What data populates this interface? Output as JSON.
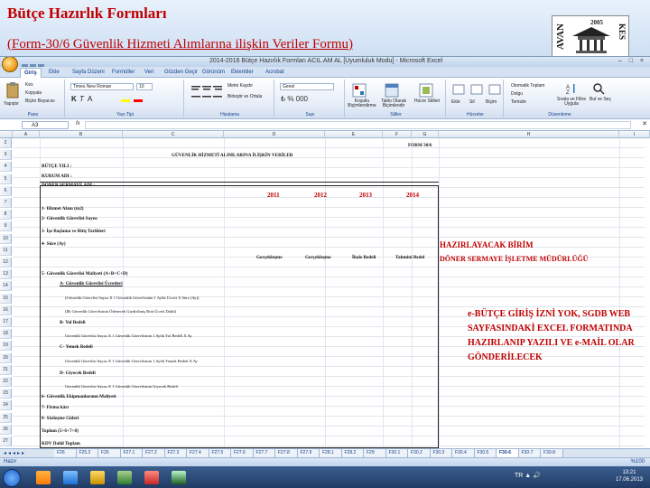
{
  "slide": {
    "title": "Bütçe Hazırlık Formları",
    "subtitle": "(Form-30/6 Güvenlik Hizmeti Alımlarına ilişkin Veriler Formu)",
    "logo_year": "2005",
    "logo_left": "AVAN",
    "logo_right": "KES"
  },
  "excel": {
    "window_title": "2014-2016 Bütçe Hazırlık Formları ACIL.AM AL [Uyumluluk Modu] - Microsoft Excel",
    "window_controls": "– □ ×",
    "tabs": [
      "Giriş",
      "Ekle",
      "Sayfa Düzeni",
      "Formüller",
      "Veri",
      "Gözden Geçir",
      "Görünüm",
      "Eklentiler",
      "Acrobat"
    ],
    "ribbon": {
      "paste": "Yapıştır",
      "cut": "Kes",
      "copy": "Kopyala",
      "format_painter": "Biçim Boyacısı",
      "clipboard_label": "Pano",
      "font_name": "Times New Roman",
      "font_size": "10",
      "font_label": "Yazı Tipi",
      "wrap_text": "Metni Kaydır",
      "merge_center": "Birleştir ve Ortala",
      "alignment_label": "Hizalama",
      "number_format": "Genel",
      "number_label": "Sayı",
      "conditional": "Koşullu Biçimlendirme",
      "format_table": "Tablo Olarak Biçimlendir",
      "cell_styles": "Hücre Stilleri",
      "styles_label": "Stiller",
      "insert": "Ekle",
      "delete": "Sil",
      "format": "Biçim",
      "cells_label": "Hücreler",
      "autosum": "Otomatik Toplam",
      "fill": "Dolgu",
      "clear": "Temizle",
      "sort_filter": "Sırala ve Filtre Uygula",
      "find_select": "Bul ve Seç",
      "editing_label": "Düzenleme"
    },
    "name_box": "A3",
    "fx": "fx",
    "columns": [
      "A",
      "B",
      "C",
      "D",
      "E",
      "F",
      "G",
      "H",
      "I"
    ],
    "rows": [
      "2",
      "3",
      "4",
      "5",
      "6",
      "7",
      "8",
      "9",
      "10",
      "11",
      "12",
      "13",
      "14",
      "15",
      "16",
      "17",
      "18",
      "19",
      "20",
      "21",
      "22",
      "23",
      "24",
      "25",
      "26",
      "27"
    ]
  },
  "form": {
    "form_no": "FORM 30/6",
    "heading": "GÜVENLİK HİZMETİ ALIMLARINA İLİŞKİN VERİLER",
    "fiscal_year": "BÜTÇE YILI :",
    "institution": "KURUM ADI :",
    "revolving_fund": "DÖNER SERMAYE ADI :",
    "years": [
      "2011",
      "2012",
      "2013",
      "2014"
    ],
    "lines": [
      "1- Hizmet Alanı (m2)",
      "2- Güvenlik Görevlisi Sayısı",
      "3- İşe Başlama ve Bitiş Tarihleri",
      "4- Süre (Ay)",
      "5- Güvenlik Görevlisi Maliyeti (A+B+C+D)",
      "A- Güvenlik Görevlisi Ücretleri",
      "(Güvenlik Görevlisi Sayısı X 1 Güvenlik Görevlisinin 1 Aylık Ücreti X Süre (Ay))",
      "(İlk Güvenlik Görevlisinin Ödenecek Giydirilmiş Brüt Ücreti Dahil)",
      "B- Yol Bedeli",
      "Güvenlik Görevlisi Sayısı X 1 Güvenlik Görevlisinin 1 Aylık Yol Bedeli X Ay",
      "C- Yemek Bedeli",
      "Güvenlik Görevlisi Sayısı X 1 Güvenlik Görevlisinin 1 Aylık Yemek Bedeli X Ay",
      "D- Giyecek Bedeli",
      "Güvenlik Görevlisi Sayısı X 1 Güvenlik Görevlisinin Giyecek Bedeli",
      "6- Güvenlik Ekipmanlarının Maliyeti",
      "7- Firma kârı",
      "8- Sözleşme Gideri",
      "Toplam (5+6+7+8)",
      "KDV Dahil Toplam"
    ],
    "subheaders": [
      "Gerçekleşme",
      "Gerçekleşme",
      "İhale Bedeli",
      "Tahmini Bedel"
    ]
  },
  "notes": {
    "preparer_label": "HAZIRLAYACAK BİRİM",
    "preparer_value": "DÖNER SERMAYE İŞLETME MÜDÜRLÜĞÜ",
    "instruction": [
      "e-BÜTÇE GİRİŞ İZNİ YOK, SGDB WEB",
      "SAYFASINDAKİ EXCEL FORMATINDA",
      "HAZIRLANIP YAZILI VE e-MAİL OLAR",
      "GÖNDERİLECEK"
    ]
  },
  "sheet_tabs": [
    "F26",
    "F25.2",
    "F26",
    "F27.1",
    "F27.2",
    "F27.3",
    "F27.4",
    "F27.5",
    "F27.6",
    "F27.7",
    "F27.8",
    "F27.9",
    "F28.1",
    "F28.2",
    "F29",
    "F30.1",
    "F30.2",
    "F30.3",
    "F30.4",
    "F30.5",
    "F30-6",
    "F30-7",
    "F30-8"
  ],
  "active_sheet": "F30-6",
  "status": {
    "left": "Hazır",
    "zoom": "%100"
  },
  "taskbar": {
    "tray": "TR  ▲ 🔊",
    "time": "13:21",
    "date": "17.06.2013"
  }
}
